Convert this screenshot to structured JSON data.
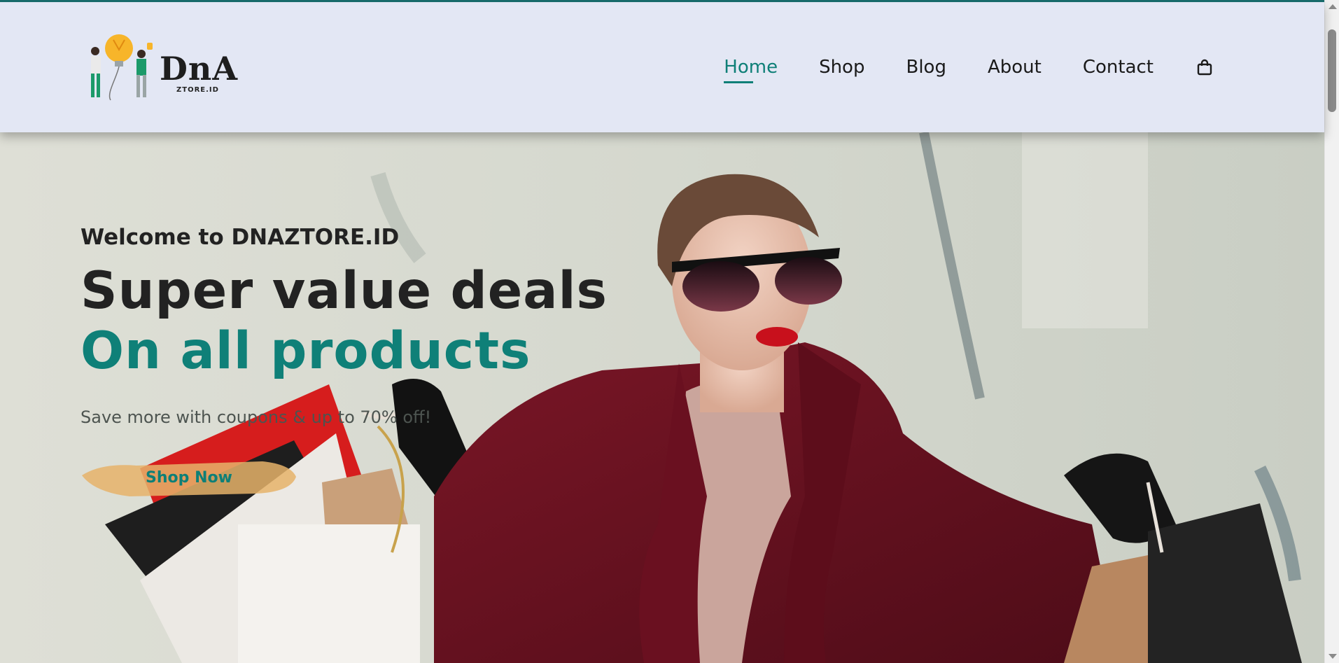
{
  "brand": {
    "logo_title": "DnA",
    "logo_subtitle": "ZTORE.ID",
    "accent_color": "#0e7f77"
  },
  "nav": {
    "items": [
      {
        "label": "Home",
        "active": true
      },
      {
        "label": "Shop",
        "active": false
      },
      {
        "label": "Blog",
        "active": false
      },
      {
        "label": "About",
        "active": false
      },
      {
        "label": "Contact",
        "active": false
      }
    ],
    "cart_icon": "shopping-bag-icon"
  },
  "hero": {
    "welcome": "Welcome to DNAZTORE.ID",
    "headline": "Super value deals",
    "subline": "On all products",
    "tagline": "Save more with coupons & up to 70% off!",
    "cta_label": "Shop Now"
  }
}
